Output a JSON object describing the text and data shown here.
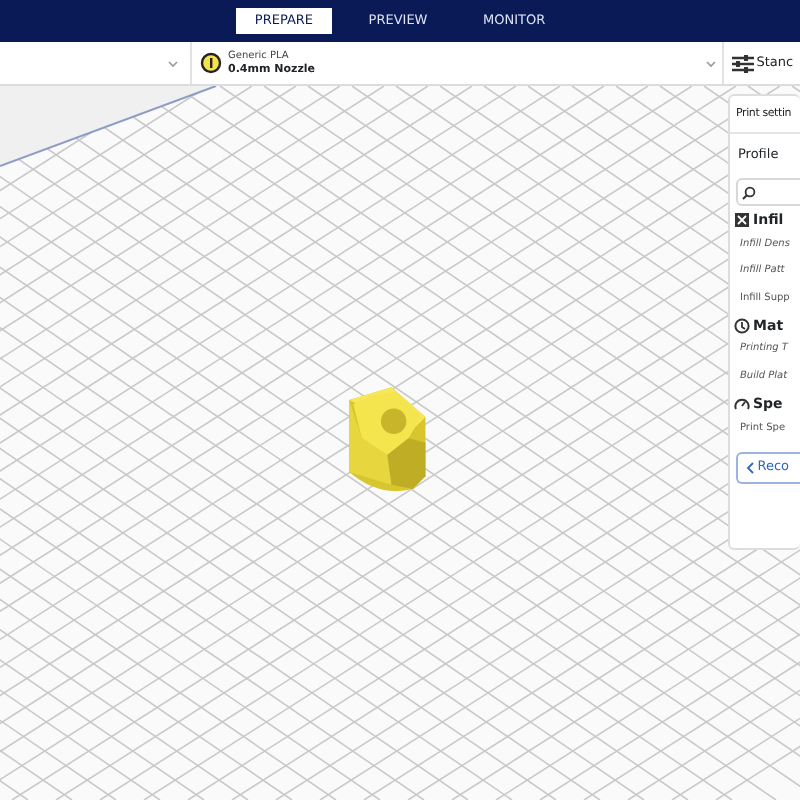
{
  "tabs": [
    {
      "label": "PREPARE",
      "selected": true
    },
    {
      "label": "PREVIEW",
      "selected": false
    },
    {
      "label": "MONITOR",
      "selected": false
    }
  ],
  "material": {
    "name": "Generic PLA",
    "nozzle": "0.4mm Nozzle"
  },
  "print_setup": {
    "label": "Stanc"
  },
  "settings_panel": {
    "title": "Print settin",
    "profile_label": "Profile",
    "sections": [
      {
        "title": "Infil",
        "kind": "infill",
        "items": [
          {
            "label": "Infill Dens",
            "inherited": true
          },
          {
            "label": "Infill Patt",
            "inherited": true
          },
          {
            "label": "Infill Supp",
            "inherited": false
          }
        ]
      },
      {
        "title": "Mat",
        "kind": "material",
        "items": [
          {
            "label": "Printing T",
            "inherited": true
          },
          {
            "label": "Build Plat",
            "inherited": true
          }
        ]
      },
      {
        "title": "Spe",
        "kind": "speed",
        "items": [
          {
            "label": "Print Spe",
            "inherited": false
          }
        ]
      }
    ],
    "button": "Reco"
  }
}
